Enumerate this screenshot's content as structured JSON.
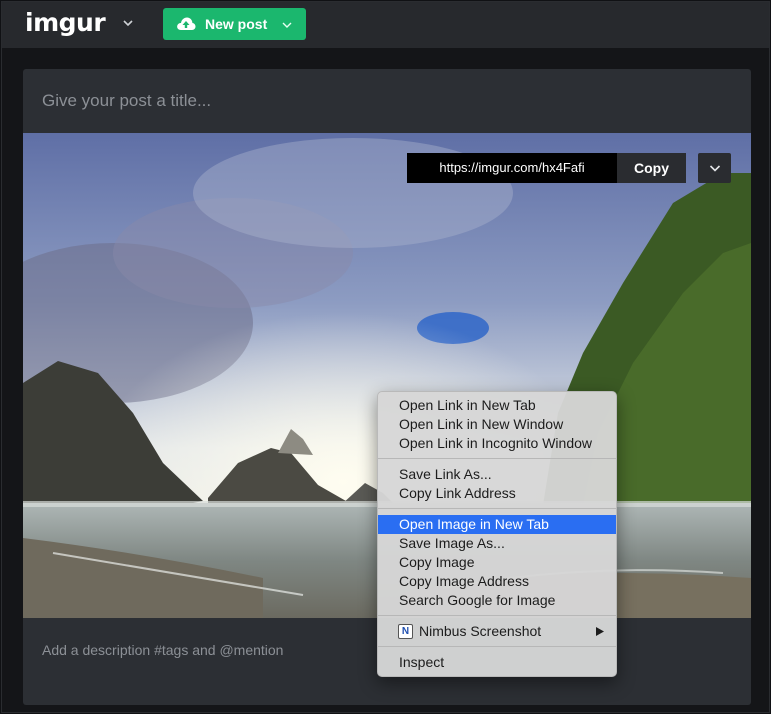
{
  "header": {
    "logo_text": "imgur",
    "new_post_label": "New post"
  },
  "post": {
    "title_placeholder": "Give your post a title...",
    "description_placeholder": "Add a description #tags and @mention"
  },
  "image_link": {
    "url": "https://imgur.com/hx4Fafi",
    "copy_label": "Copy"
  },
  "context_menu": {
    "group1": [
      "Open Link in New Tab",
      "Open Link in New Window",
      "Open Link in Incognito Window"
    ],
    "group2": [
      "Save Link As...",
      "Copy Link Address"
    ],
    "group3": [
      "Open Image in New Tab",
      "Save Image As...",
      "Copy Image",
      "Copy Image Address",
      "Search Google for Image"
    ],
    "nimbus_label": "Nimbus Screenshot",
    "nimbus_icon_letter": "N",
    "inspect_label": "Inspect",
    "highlighted_item": "Open Image in New Tab"
  },
  "icons": {
    "logo_dropdown": "chevron-down-icon",
    "upload": "cloud-upload-icon",
    "new_post_dropdown": "chevron-down-icon",
    "image_options": "chevron-down-icon",
    "submenu": "triangle-right-icon"
  },
  "colors": {
    "accent_green": "#1bb76e",
    "menu_highlight": "#2a6ef2",
    "topbar": "#27292d",
    "card": "#2c2f34"
  }
}
